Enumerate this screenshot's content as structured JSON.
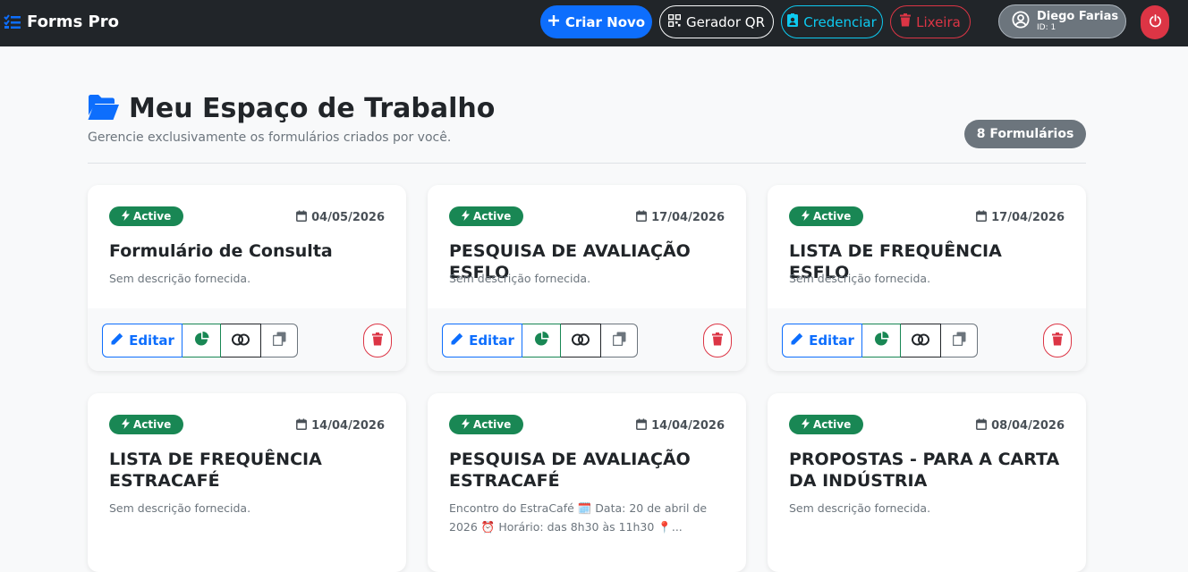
{
  "navbar": {
    "brand": "Forms Pro",
    "create_label": "Criar Novo",
    "qr_label": "Gerador QR",
    "credential_label": "Credenciar",
    "trash_label": "Lixeira",
    "user_name": "Diego Farias",
    "user_id": "ID: 1"
  },
  "workspace": {
    "title": "Meu Espaço de Trabalho",
    "subtitle": "Gerencie exclusivamente os formulários criados por você.",
    "count": "8 Formulários"
  },
  "card_actions": {
    "edit_label": "Editar"
  },
  "cards": [
    {
      "status": "Active",
      "date": "04/05/2026",
      "title": "Formulário de Consulta",
      "description": "Sem descrição fornecida."
    },
    {
      "status": "Active",
      "date": "17/04/2026",
      "title": "PESQUISA DE AVALIAÇÃO ESFLO",
      "description": "Sem descrição fornecida."
    },
    {
      "status": "Active",
      "date": "17/04/2026",
      "title": "LISTA DE FREQUÊNCIA ESFLO",
      "description": "Sem descrição fornecida."
    },
    {
      "status": "Active",
      "date": "14/04/2026",
      "title": "LISTA DE FREQUÊNCIA ESTRACAFÉ",
      "description": "Sem descrição fornecida."
    },
    {
      "status": "Active",
      "date": "14/04/2026",
      "title": "PESQUISA DE AVALIAÇÃO ESTRACAFÉ",
      "description": "Encontro do EstraCafé 🗓️ Data: 20 de abril de 2026 ⏰ Horário: das 8h30 às 11h30 📍..."
    },
    {
      "status": "Active",
      "date": "08/04/2026",
      "title": "PROPOSTAS - PARA A CARTA DA INDÚSTRIA",
      "description": "Sem descrição fornecida."
    }
  ],
  "colors": {
    "navbar": "#212529",
    "primary": "#0d6efd",
    "success": "#198754",
    "danger": "#dc3545",
    "info": "#0dcaf0",
    "secondary": "#6c757d"
  }
}
